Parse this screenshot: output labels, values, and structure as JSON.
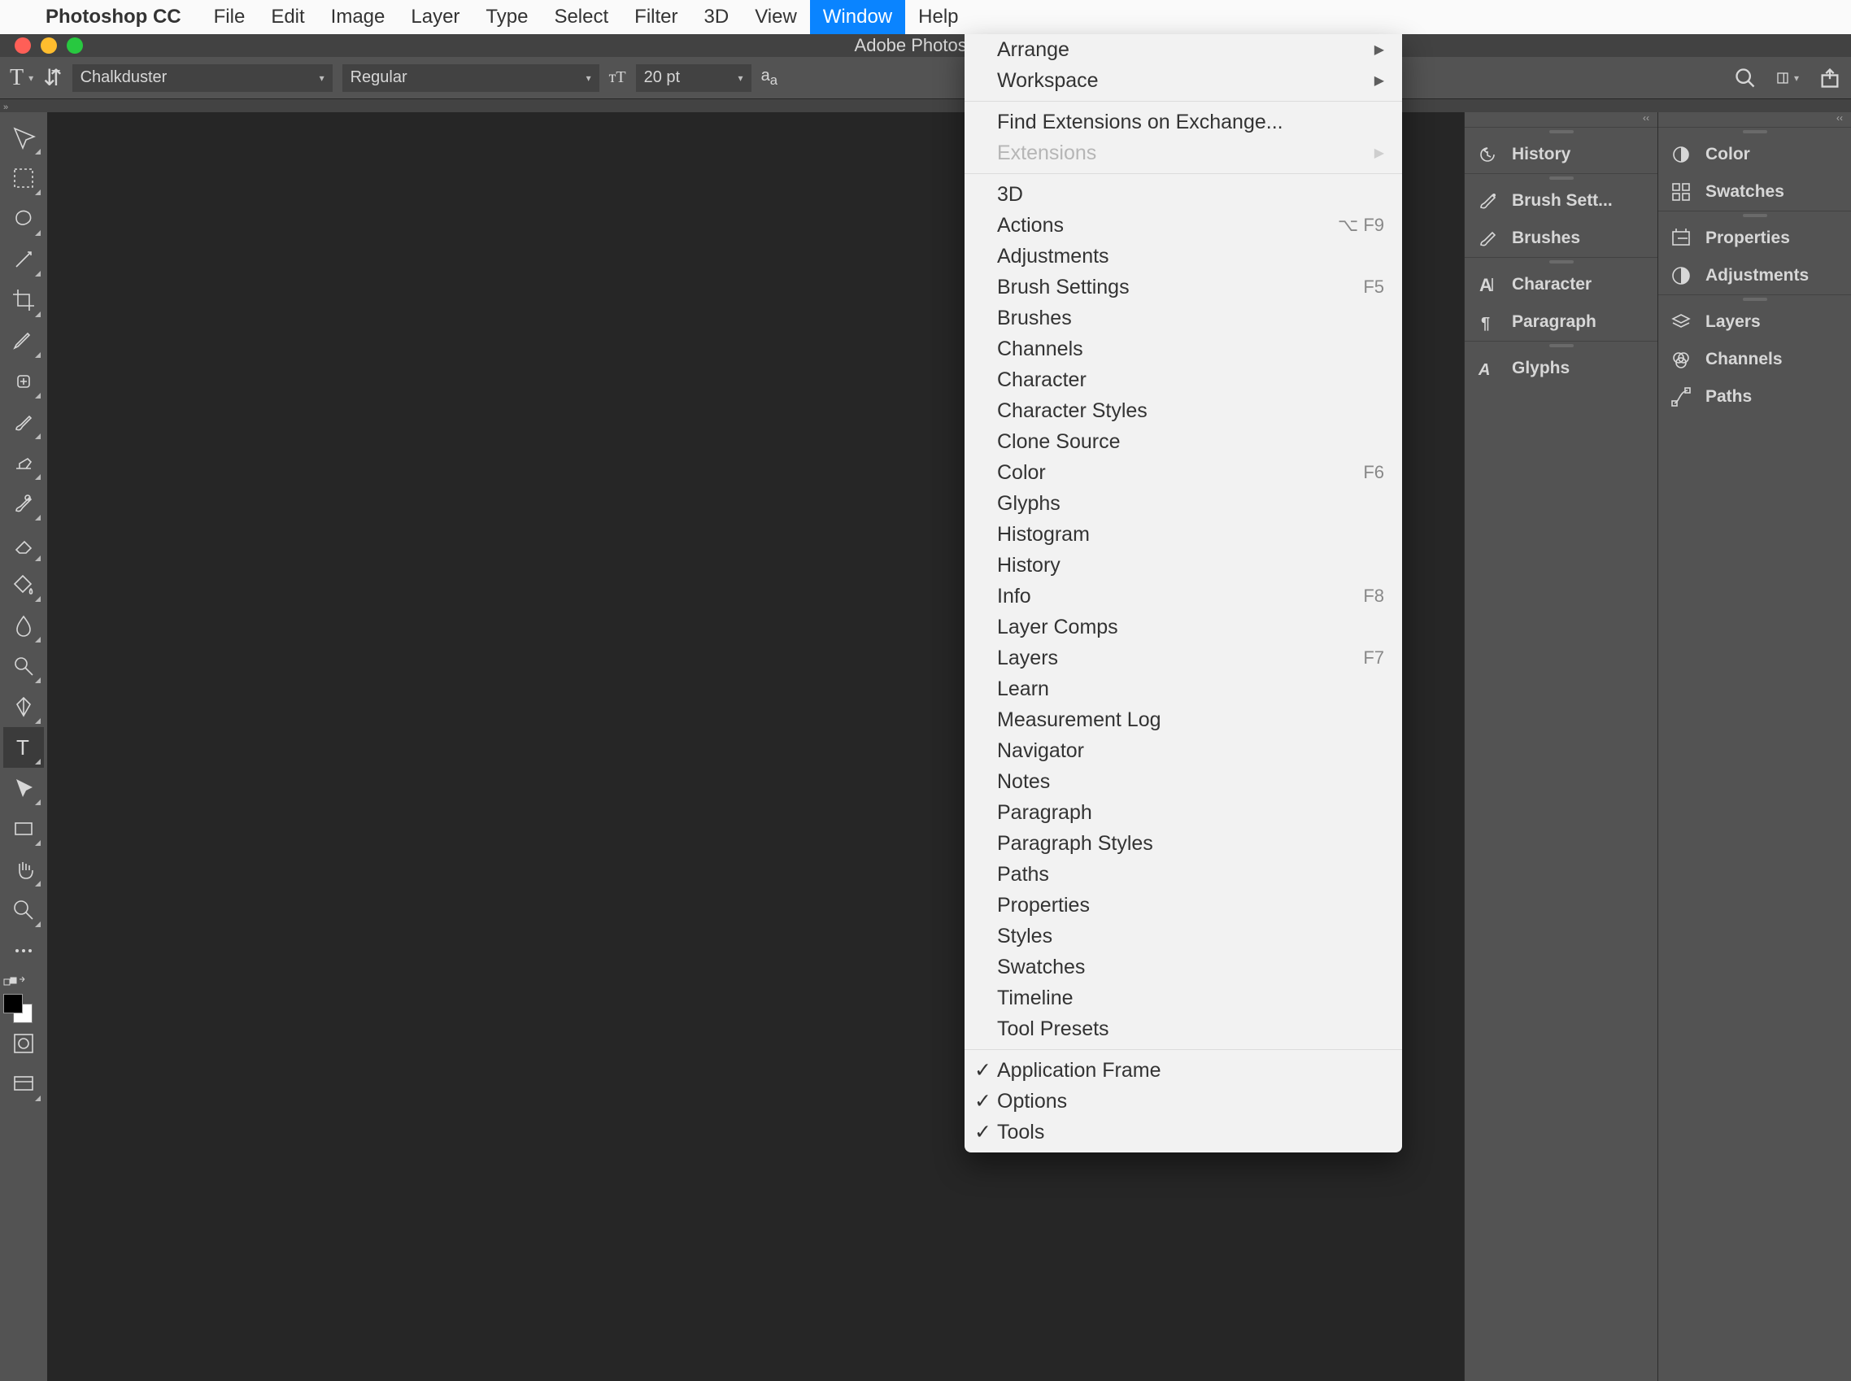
{
  "menubar": {
    "app": "Photoshop CC",
    "items": [
      "File",
      "Edit",
      "Image",
      "Layer",
      "Type",
      "Select",
      "Filter",
      "3D",
      "View",
      "Window",
      "Help"
    ],
    "active": "Window"
  },
  "titlebar": {
    "title": "Adobe Photoshop"
  },
  "options": {
    "font": "Chalkduster",
    "weight": "Regular",
    "size": "20 pt"
  },
  "window_menu": {
    "group1": [
      {
        "label": "Arrange",
        "sub": true
      },
      {
        "label": "Workspace",
        "sub": true
      }
    ],
    "group2": [
      {
        "label": "Find Extensions on Exchange..."
      },
      {
        "label": "Extensions",
        "sub": true,
        "disabled": true
      }
    ],
    "group3": [
      {
        "label": "3D"
      },
      {
        "label": "Actions",
        "short": "⌥ F9"
      },
      {
        "label": "Adjustments"
      },
      {
        "label": "Brush Settings",
        "short": "F5"
      },
      {
        "label": "Brushes"
      },
      {
        "label": "Channels"
      },
      {
        "label": "Character"
      },
      {
        "label": "Character Styles"
      },
      {
        "label": "Clone Source"
      },
      {
        "label": "Color",
        "short": "F6"
      },
      {
        "label": "Glyphs"
      },
      {
        "label": "Histogram"
      },
      {
        "label": "History"
      },
      {
        "label": "Info",
        "short": "F8"
      },
      {
        "label": "Layer Comps"
      },
      {
        "label": "Layers",
        "short": "F7"
      },
      {
        "label": "Learn"
      },
      {
        "label": "Measurement Log"
      },
      {
        "label": "Navigator"
      },
      {
        "label": "Notes"
      },
      {
        "label": "Paragraph"
      },
      {
        "label": "Paragraph Styles"
      },
      {
        "label": "Paths"
      },
      {
        "label": "Properties"
      },
      {
        "label": "Styles"
      },
      {
        "label": "Swatches"
      },
      {
        "label": "Timeline"
      },
      {
        "label": "Tool Presets"
      }
    ],
    "group4": [
      {
        "label": "Application Frame",
        "checked": true
      },
      {
        "label": "Options",
        "checked": true
      },
      {
        "label": "Tools",
        "checked": true
      }
    ]
  },
  "panels": {
    "col1": [
      [
        "History"
      ],
      [
        "Brush Sett...",
        "Brushes"
      ],
      [
        "Character",
        "Paragraph"
      ],
      [
        "Glyphs"
      ]
    ],
    "col2": [
      [
        "Color",
        "Swatches"
      ],
      [
        "Properties",
        "Adjustments"
      ],
      [
        "Layers",
        "Channels",
        "Paths"
      ]
    ]
  },
  "tools": [
    "move-tool",
    "marquee-tool",
    "lasso-tool",
    "magic-wand-tool",
    "crop-tool",
    "eyedropper-tool",
    "healing-brush-tool",
    "brush-tool",
    "clone-stamp-tool",
    "history-brush-tool",
    "eraser-tool",
    "paint-bucket-tool",
    "blur-tool",
    "dodge-tool",
    "pen-tool",
    "type-tool",
    "path-select-tool",
    "rectangle-tool",
    "hand-tool",
    "zoom-tool",
    "more-tools"
  ],
  "active_tool": "type-tool"
}
